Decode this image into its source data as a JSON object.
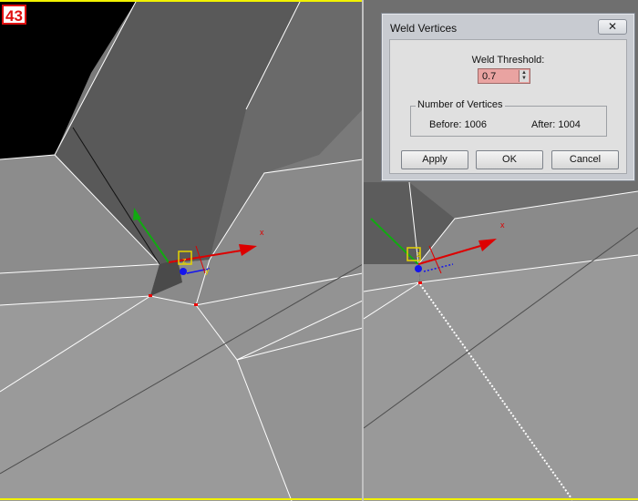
{
  "step_badge": "43",
  "dialog": {
    "title": "Weld Vertices",
    "close_label": "✕",
    "threshold_label": "Weld Threshold:",
    "threshold_value": "0.7",
    "vertex_group_title": "Number of Vertices",
    "before_label": "Before:",
    "before_value": "1006",
    "after_label": "After:",
    "after_value": "1004",
    "apply_label": "Apply",
    "ok_label": "OK",
    "cancel_label": "Cancel"
  },
  "gizmo": {
    "x_label": "x",
    "y_label": "y",
    "z_label": "z",
    "x_color": "#dd0000",
    "y_color": "#11aa11",
    "z_color": "#1414ee",
    "plane_color": "#e6d400"
  },
  "colors": {
    "frame_yellow": "#f2f200",
    "badge_red": "#e01010",
    "viewport_bg": "#000000",
    "highlight_field": "#e9a3a1"
  }
}
